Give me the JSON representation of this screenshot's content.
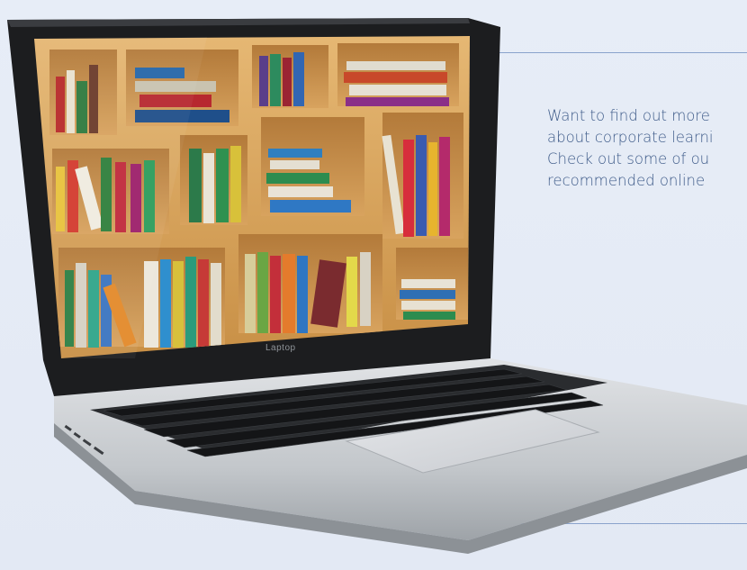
{
  "promo": {
    "line1": "Want to find out more",
    "line2": "about corporate learni",
    "line3": "Check out some of ou",
    "line4": "recommended online"
  },
  "laptop": {
    "brand_label": "Laptop"
  },
  "colors": {
    "background": "#e6ecf6",
    "accent_text": "#3d5a88",
    "rule": "#8aa3cc",
    "shelf_wood": "#d9a862",
    "bezel": "#1c1d1f",
    "aluminum": "#c9ccd0"
  }
}
